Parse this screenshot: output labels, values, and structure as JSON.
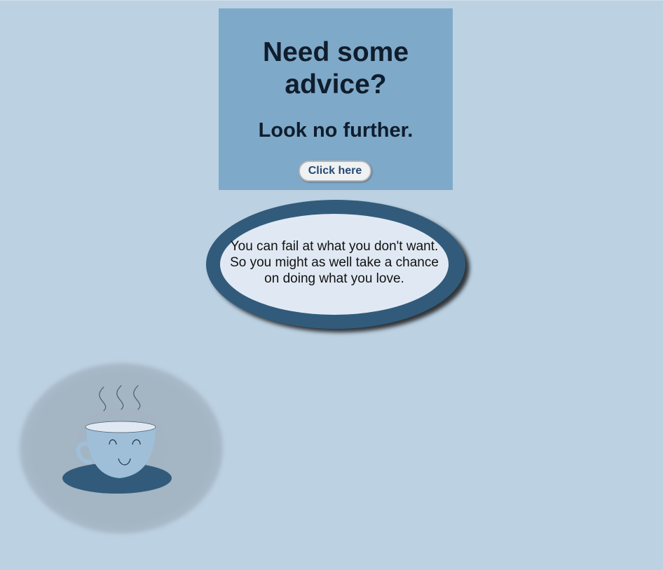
{
  "hero": {
    "title": "Need some advice?",
    "subtitle": "Look no further.",
    "button_label": "Click here"
  },
  "quote": {
    "text": "You can fail at what you don't want. So you might as well take a chance on doing what you love."
  },
  "illustration": {
    "icon": "coffee-cup-icon",
    "steam_icon": "steam-icon"
  },
  "colors": {
    "background": "#bcd1e2",
    "card": "#7fa9c9",
    "dark_accent": "#325b7b",
    "quote_fill": "#e0e9f3",
    "cup_fill": "#9fbfd9"
  }
}
